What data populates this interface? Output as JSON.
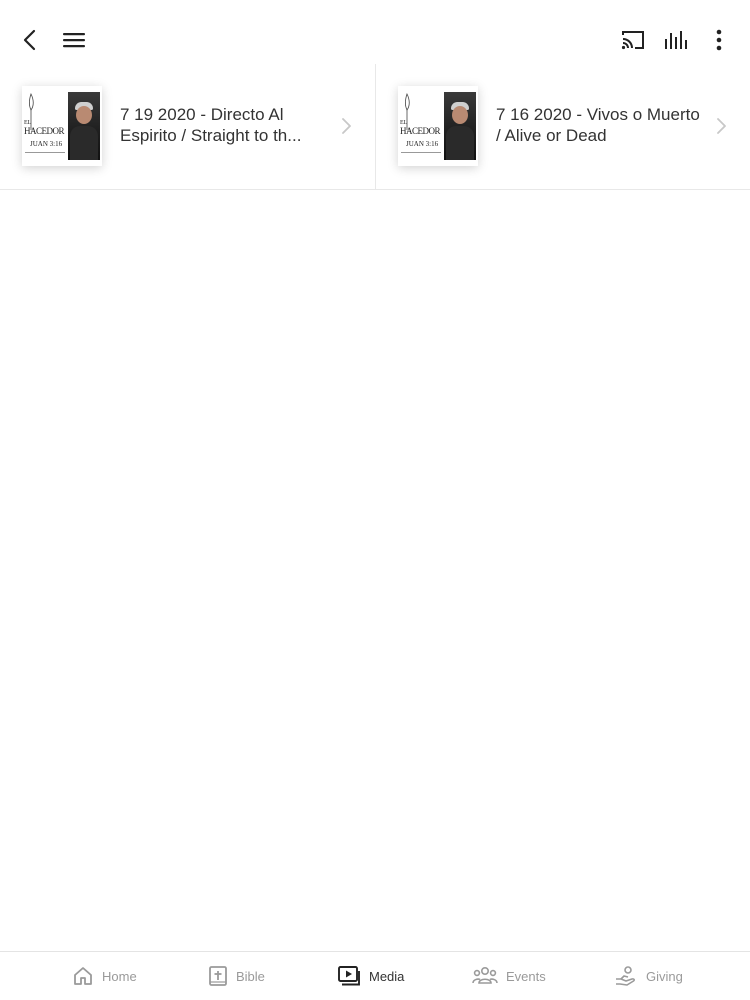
{
  "header": {
    "back_icon": "chevron-left-icon",
    "menu_icon": "hamburger-menu-icon",
    "cast_icon": "cast-icon",
    "audio_icon": "audio-bars-icon",
    "more_icon": "more-vertical-icon"
  },
  "media": {
    "items": [
      {
        "title": "7 19 2020 - Directo Al Espirito / Straight to th...",
        "thumbnail_icon": "el-hacedor-thumbnail"
      },
      {
        "title": "7 16 2020 - Vivos o Muerto / Alive or Dead",
        "thumbnail_icon": "el-hacedor-thumbnail"
      }
    ]
  },
  "tabbar": {
    "tabs": [
      {
        "label": "Home",
        "icon": "home-icon",
        "active": false
      },
      {
        "label": "Bible",
        "icon": "bible-icon",
        "active": false
      },
      {
        "label": "Media",
        "icon": "media-play-icon",
        "active": true
      },
      {
        "label": "Events",
        "icon": "people-icon",
        "active": false
      },
      {
        "label": "Giving",
        "icon": "giving-hand-icon",
        "active": false
      }
    ]
  },
  "colors": {
    "text_primary": "#333333",
    "text_inactive": "#9a9a9a",
    "divider": "#e8e8e8",
    "background": "#ffffff"
  }
}
